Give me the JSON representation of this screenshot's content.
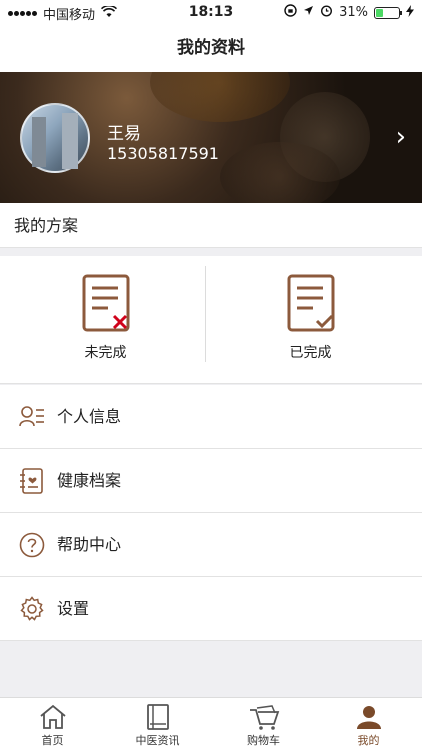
{
  "status_bar": {
    "carrier": "中国移动",
    "time": "18:13",
    "battery": "31%",
    "battery_level": 0.31
  },
  "nav": {
    "title": "我的资料"
  },
  "profile": {
    "name": "王易",
    "phone": "15305817591"
  },
  "section": {
    "title": "我的方案"
  },
  "plans": {
    "incomplete": "未完成",
    "complete": "已完成"
  },
  "menu": [
    {
      "label": "个人信息",
      "icon": "user-info-icon"
    },
    {
      "label": "健康档案",
      "icon": "health-record-icon"
    },
    {
      "label": "帮助中心",
      "icon": "help-icon"
    },
    {
      "label": "设置",
      "icon": "settings-icon"
    }
  ],
  "tabs": [
    {
      "label": "首页",
      "icon": "home-icon"
    },
    {
      "label": "中医资讯",
      "icon": "book-icon"
    },
    {
      "label": "购物车",
      "icon": "cart-icon"
    },
    {
      "label": "我的",
      "icon": "profile-icon"
    }
  ],
  "colors": {
    "accent": "#7a4a2a",
    "icon_brown": "#8c5a3c",
    "error_red": "#d0021b"
  }
}
